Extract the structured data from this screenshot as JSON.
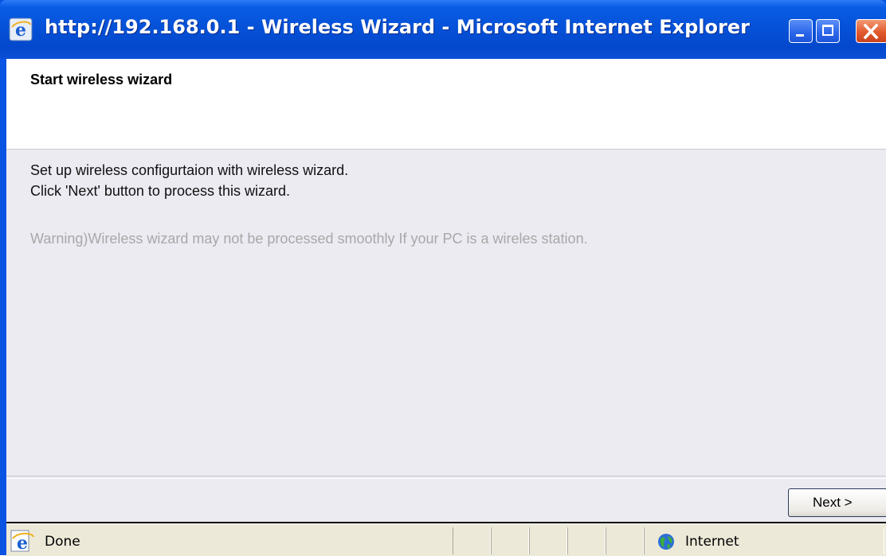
{
  "window": {
    "title": "http://192.168.0.1 - Wireless Wizard - Microsoft Internet Explorer",
    "icon": "internet-explorer-icon",
    "controls": {
      "minimize": "minimize-icon",
      "maximize": "maximize-icon",
      "close": "close-icon"
    }
  },
  "wizard": {
    "heading": "Start wireless wizard",
    "line1": "Set up wireless configurtaion with wireless wizard.",
    "line2": "Click 'Next' button to process this wizard.",
    "warning": "Warning)Wireless wizard may not be processed smoothly If your PC is a wireles station.",
    "next_label": "Next >"
  },
  "statusbar": {
    "status": "Done",
    "zone": "Internet"
  },
  "colors": {
    "titlebar": "#0552d8",
    "content_bg": "#ecebf2",
    "warning_text": "#a8a8a8",
    "statusbar_bg": "#ece9d8"
  }
}
